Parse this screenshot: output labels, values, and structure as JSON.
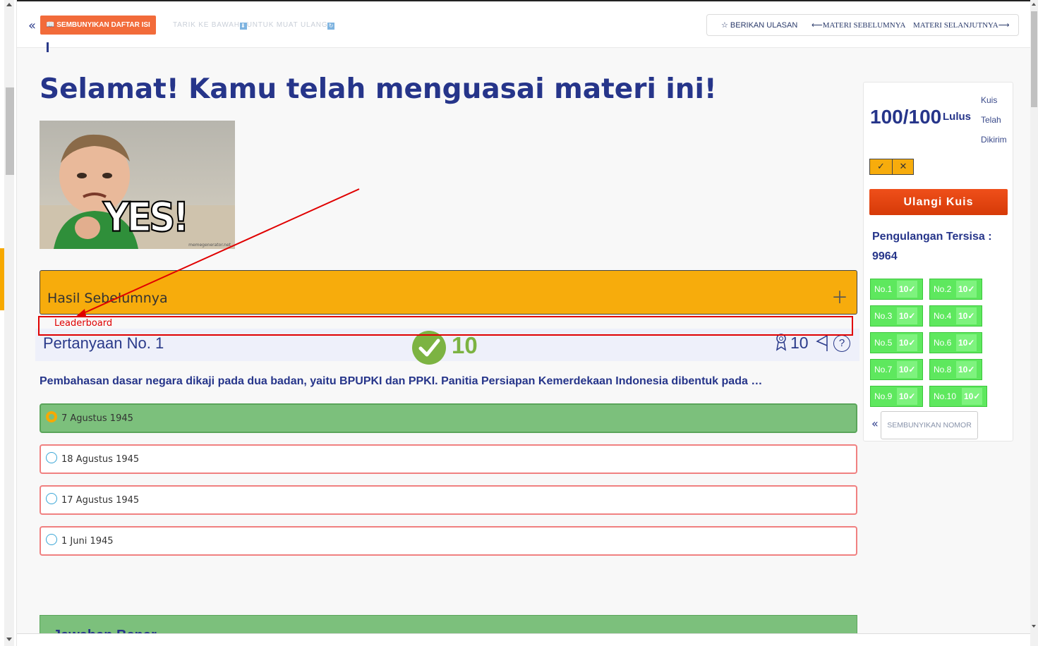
{
  "topbar": {
    "hide_toc_label": "📖 SEMBUNYIKAN DAFTAR ISI",
    "pull_hint_a": "TARIK KE BAWAH",
    "pull_hint_b": "UNTUK MUAT ULANG",
    "review_label": "☆  BERIKAN ULASAN",
    "prev_label": "MATERI SEBELUMNYA",
    "next_label": "MATERI SELANJUTNYA"
  },
  "main": {
    "title": "Selamat! Kamu telah menguasai materi ini!",
    "meme_text": "YES!",
    "meme_credit": "memegenerator.net",
    "prev_results_label": "Hasil Sebelumnya",
    "leaderboard_label": "Leaderboard",
    "question_title": "Pertanyaan No. 1",
    "score_big": "10",
    "points": "10",
    "help_symbol": "?",
    "question_text": "Pembahasan dasar negara dikaji pada dua badan, yaitu BPUPKI dan PPKI. Panitia Persiapan Kemerdekaan Indonesia dibentuk pada …",
    "options": [
      {
        "label": "7 Agustus 1945",
        "correct": true
      },
      {
        "label": "18 Agustus 1945",
        "correct": false
      },
      {
        "label": "17 Agustus 1945",
        "correct": false
      },
      {
        "label": "1 Juni 1945",
        "correct": false
      }
    ],
    "answer_label": "Jawaban Benar"
  },
  "side": {
    "score": "100/100",
    "pass_label": "Lulus",
    "quiz_sent_1": "Kuis",
    "quiz_sent_2": "Telah",
    "quiz_sent_3": "Dikirim",
    "toggle_check": "✓",
    "toggle_cross": "✕",
    "retry_label": "Ulangi Kuis",
    "remaining_label": "Pengulangan Tersisa :",
    "remaining_value": "9964",
    "numbers": [
      {
        "label": "No.1",
        "score": "10✓"
      },
      {
        "label": "No.2",
        "score": "10✓"
      },
      {
        "label": "No.3",
        "score": "10✓"
      },
      {
        "label": "No.4",
        "score": "10✓"
      },
      {
        "label": "No.5",
        "score": "10✓"
      },
      {
        "label": "No.6",
        "score": "10✓"
      },
      {
        "label": "No.7",
        "score": "10✓"
      },
      {
        "label": "No.8",
        "score": "10✓"
      },
      {
        "label": "No.9",
        "score": "10✓"
      },
      {
        "label": "No.10",
        "score": "10✓"
      }
    ],
    "hide_numbers_label": "SEMBUNYIKAN NOMOR"
  },
  "colors": {
    "accent_blue": "#26358a",
    "accent_orange": "#f7ac0c",
    "correct_green": "#7cc07c",
    "tile_green": "#5ee85e",
    "annotation_red": "#e00000"
  }
}
